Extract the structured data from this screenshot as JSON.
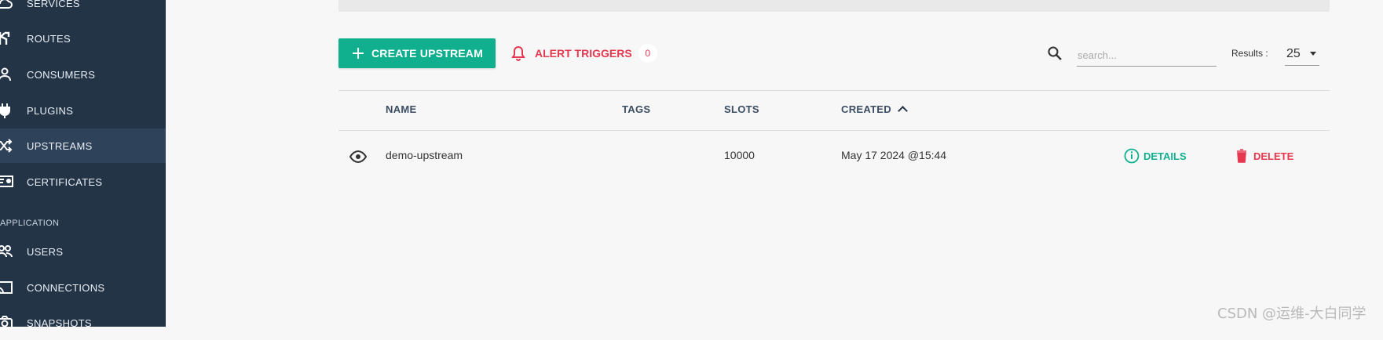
{
  "sidebar": {
    "items": [
      {
        "label": "SERVICES",
        "icon": "cloud-icon"
      },
      {
        "label": "ROUTES",
        "icon": "route-icon"
      },
      {
        "label": "CONSUMERS",
        "icon": "person-icon"
      },
      {
        "label": "PLUGINS",
        "icon": "plug-icon"
      },
      {
        "label": "UPSTREAMS",
        "icon": "shuffle-icon"
      },
      {
        "label": "CERTIFICATES",
        "icon": "certificate-icon"
      }
    ],
    "section_application": "APPLICATION",
    "app_items": [
      {
        "label": "USERS",
        "icon": "users-icon"
      },
      {
        "label": "CONNECTIONS",
        "icon": "cast-icon"
      },
      {
        "label": "SNAPSHOTS",
        "icon": "camera-icon"
      }
    ],
    "active": "UPSTREAMS"
  },
  "toolbar": {
    "create_label": "CREATE UPSTREAM",
    "alert_label": "ALERT TRIGGERS",
    "alert_count": "0",
    "search_placeholder": "search...",
    "results_label": "Results :",
    "results_value": "25"
  },
  "table": {
    "headers": {
      "name": "NAME",
      "tags": "TAGS",
      "slots": "SLOTS",
      "created": "CREATED"
    },
    "sort": "created-ascending",
    "rows": [
      {
        "name": "demo-upstream",
        "tags": "",
        "slots": "10000",
        "created": "May 17 2024 @15:44",
        "details_label": "DETAILS",
        "delete_label": "DELETE"
      }
    ]
  },
  "colors": {
    "sidebar": "#243447",
    "accent": "#10b08f",
    "danger": "#e53950"
  },
  "watermark": "CSDN @运维-大白同学"
}
